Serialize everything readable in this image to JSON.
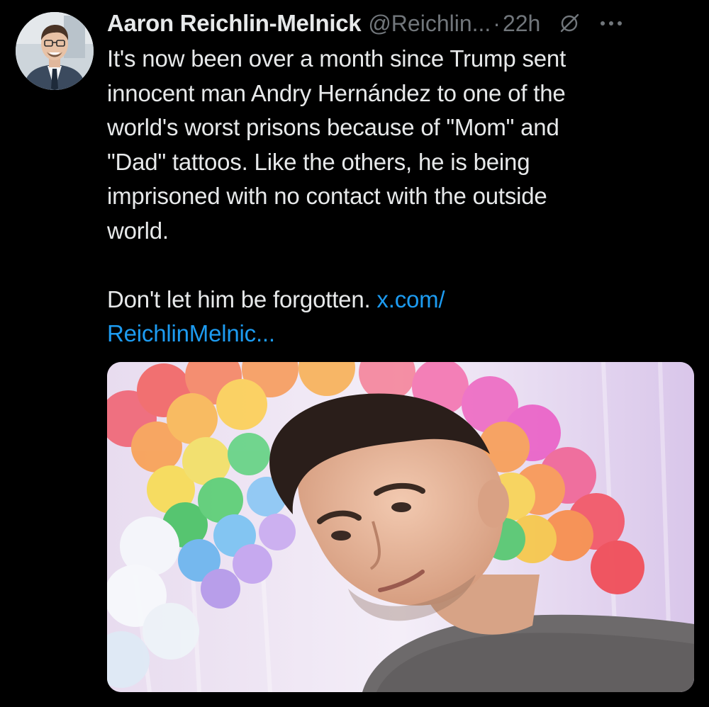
{
  "tweet": {
    "author": {
      "display_name": "Aaron Reichlin-Melnick",
      "handle": "@Reichlin...",
      "avatar": "profile-photo"
    },
    "separator": "·",
    "time": "22h",
    "icons": {
      "grok": "slashed-circle-icon",
      "more": "more-options-icon"
    },
    "text_lines": [
      "It's now been over a month since Trump sent",
      "innocent man Andry Hernández to one of the",
      "world's worst prisons because of \"Mom\" and",
      "\"Dad\" tattoos. Like the others, he is being",
      "imprisoned with no contact with the outside",
      "world."
    ],
    "text_line_last_prefix": "Don't let him be forgotten. ",
    "link_part1": "x.com/",
    "link_part2": "ReichlinMelnic...",
    "media": "photo of a young man in a grey sweater in front of a rainbow balloon arch"
  },
  "colors": {
    "background": "#000000",
    "text": "#e7e9ea",
    "secondary": "#71767b",
    "link": "#1d9bf0"
  }
}
